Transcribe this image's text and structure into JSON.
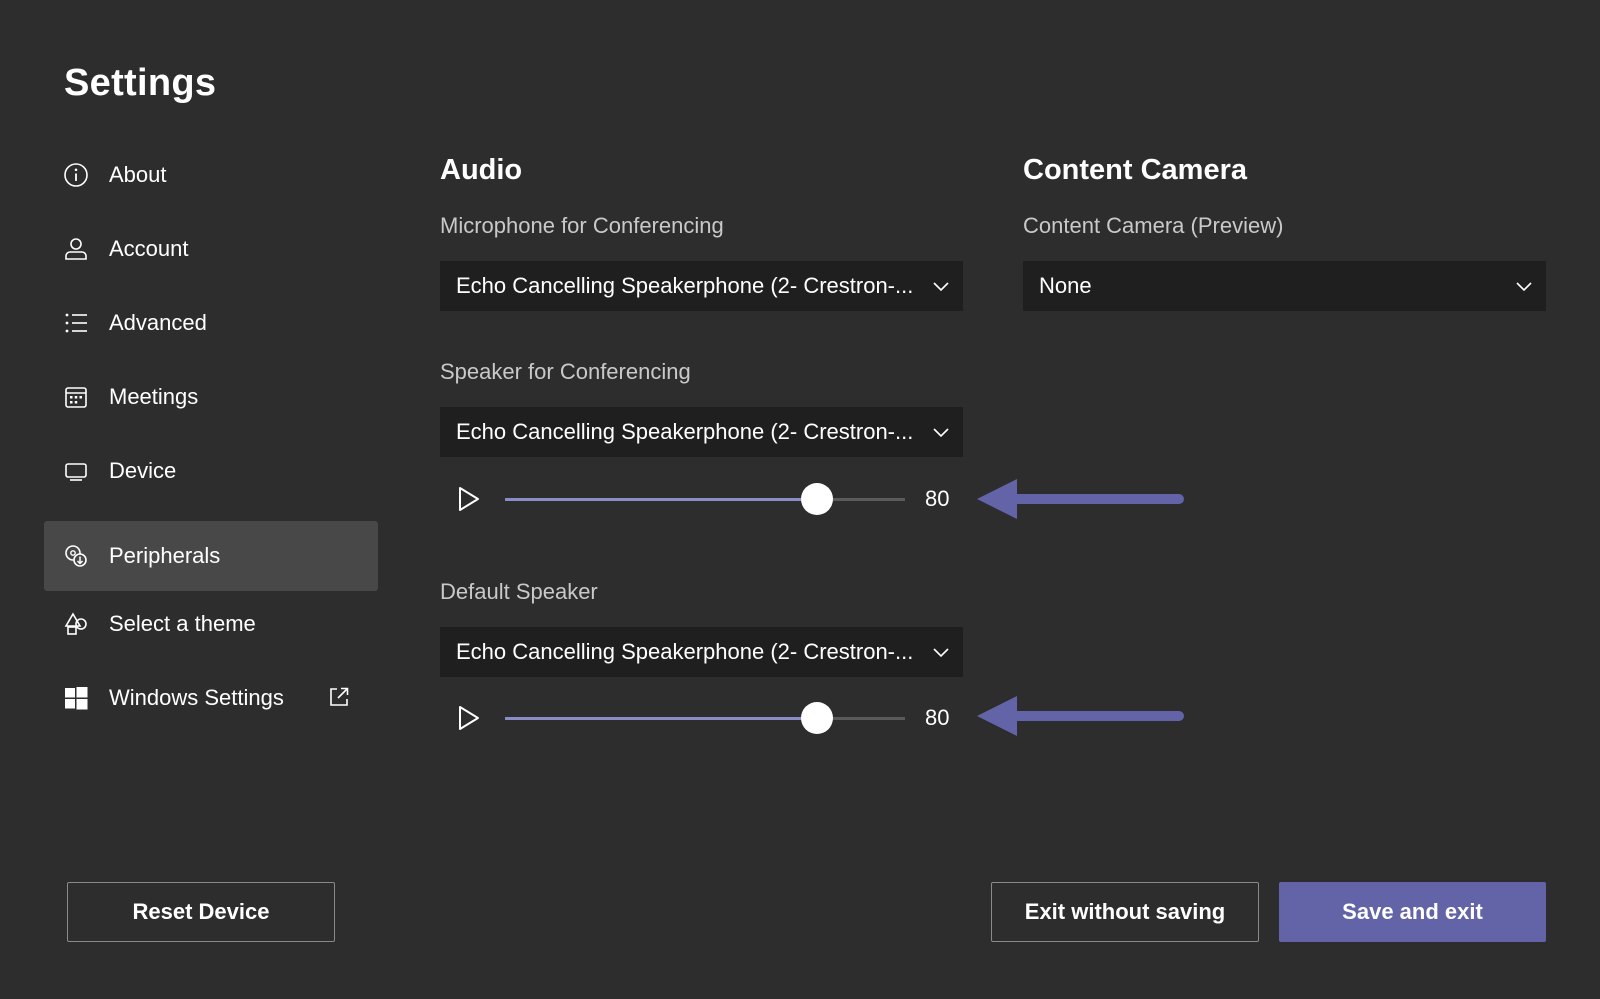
{
  "page": {
    "title": "Settings"
  },
  "sidebar": {
    "items": [
      {
        "label": "About",
        "icon": "info-icon"
      },
      {
        "label": "Account",
        "icon": "person-icon"
      },
      {
        "label": "Advanced",
        "icon": "list-icon"
      },
      {
        "label": "Meetings",
        "icon": "calendar-icon"
      },
      {
        "label": "Device",
        "icon": "monitor-icon"
      },
      {
        "label": "Peripherals",
        "icon": "peripherals-icon",
        "selected": true
      },
      {
        "label": "Select a theme",
        "icon": "theme-icon"
      },
      {
        "label": "Windows Settings",
        "icon": "windows-icon",
        "external": true
      }
    ]
  },
  "audio": {
    "title": "Audio",
    "microphone": {
      "label": "Microphone for Conferencing",
      "value": "Echo Cancelling Speakerphone (2- Crestron-..."
    },
    "speaker": {
      "label": "Speaker for Conferencing",
      "value": "Echo Cancelling Speakerphone (2- Crestron-...",
      "volume": 80
    },
    "default_speaker": {
      "label": "Default Speaker",
      "value": "Echo Cancelling Speakerphone (2- Crestron-...",
      "volume": 80
    }
  },
  "content_camera": {
    "title": "Content Camera",
    "preview": {
      "label": "Content Camera (Preview)",
      "value": "None"
    }
  },
  "buttons": {
    "reset": "Reset Device",
    "exit": "Exit without saving",
    "save": "Save and exit"
  },
  "colors": {
    "background": "#2d2d2e",
    "selected_nav": "#484849",
    "dropdown": "#1f1f1f",
    "accent": "#6264a7",
    "slider_fill": "#8b8cc7"
  }
}
